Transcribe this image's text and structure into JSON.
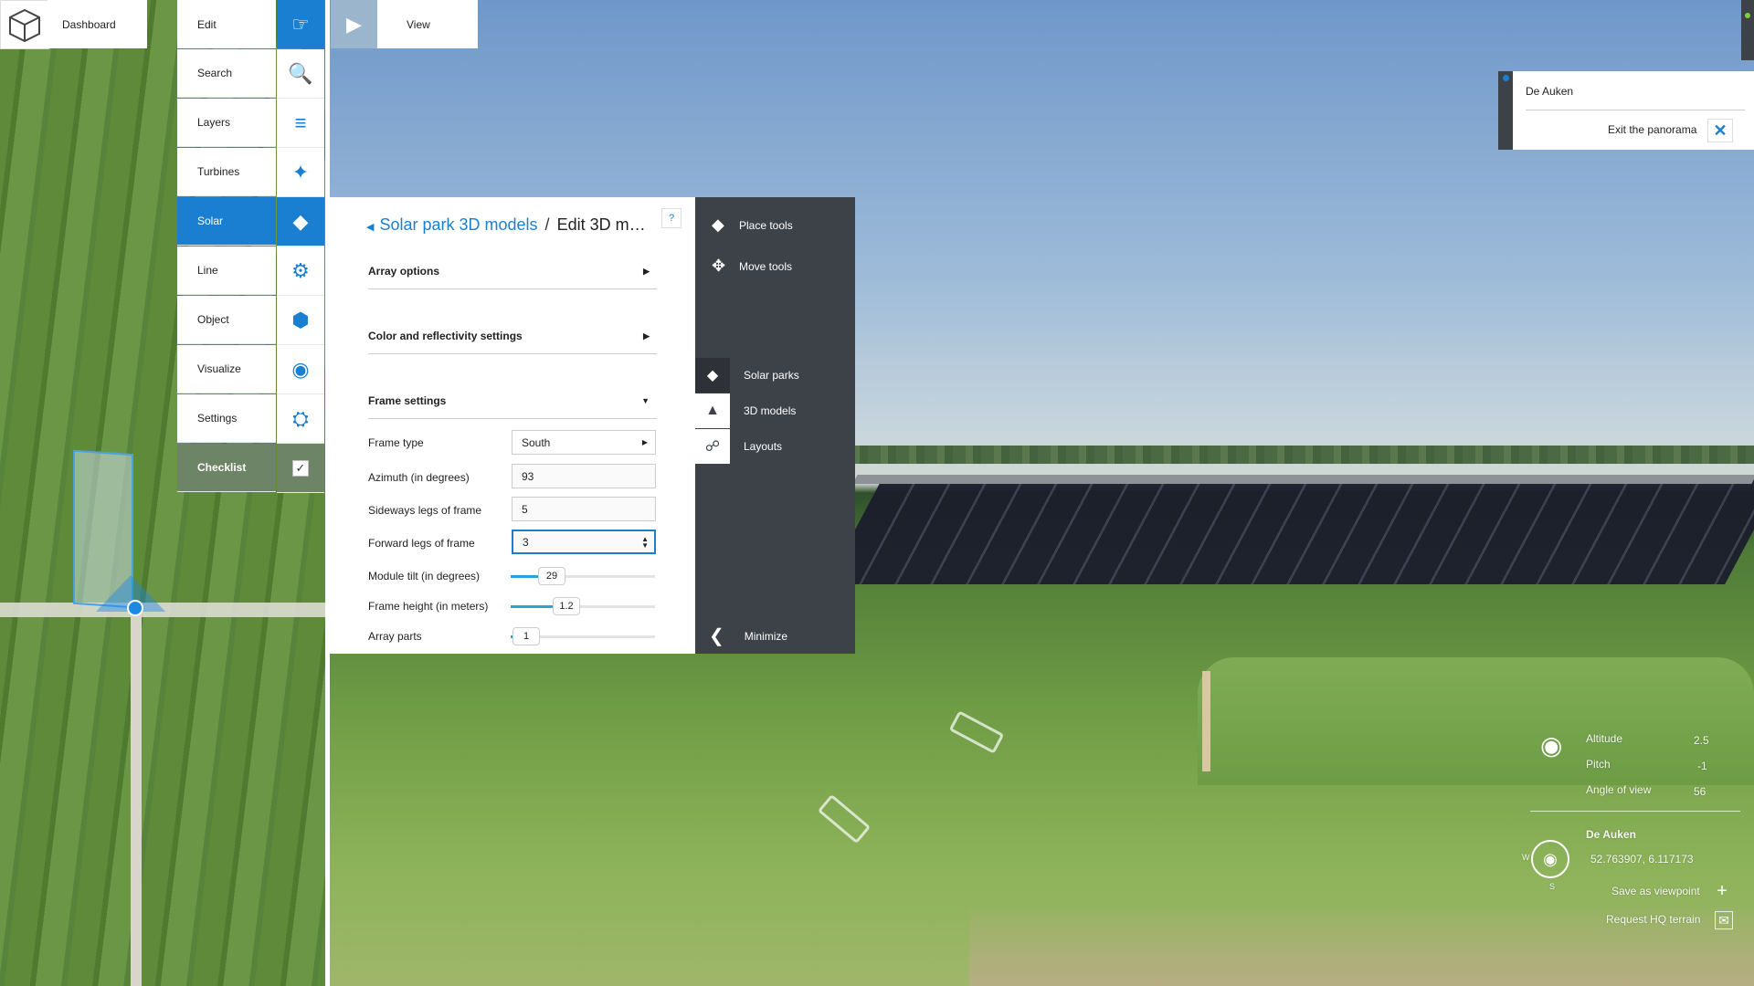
{
  "topbar": {
    "dashboard_label": "Dashboard",
    "edit_label": "Edit",
    "view_label": "View"
  },
  "menu": {
    "items": [
      {
        "label": "Search",
        "icon": "search-icon"
      },
      {
        "label": "Layers",
        "icon": "layers-icon"
      },
      {
        "label": "Turbines",
        "icon": "turbine-icon"
      },
      {
        "label": "Solar",
        "icon": "solar-panel-icon"
      },
      {
        "label": "Line",
        "icon": "line-icon"
      },
      {
        "label": "Object",
        "icon": "cube-icon"
      },
      {
        "label": "Visualize",
        "icon": "eye-icon"
      },
      {
        "label": "Settings",
        "icon": "gear-icon"
      },
      {
        "label": "Checklist",
        "icon": "checkbox-icon"
      }
    ],
    "active": "Solar"
  },
  "edit_panel": {
    "breadcrumb_parent": "Solar park 3D models",
    "breadcrumb_separator": "/",
    "breadcrumb_current": "Edit 3D m…",
    "help_label": "?",
    "sections": {
      "array_options": "Array options",
      "color_settings": "Color and reflectivity settings",
      "frame_settings": "Frame settings"
    },
    "fields": {
      "frame_type_label": "Frame type",
      "frame_type_value": "South",
      "azimuth_label": "Azimuth (in degrees)",
      "azimuth_value": "93",
      "sideways_legs_label": "Sideways legs of frame",
      "sideways_legs_value": "5",
      "forward_legs_label": "Forward legs of frame",
      "forward_legs_value": "3",
      "module_tilt_label": "Module tilt (in degrees)",
      "module_tilt_value": "29",
      "frame_height_label": "Frame height (in meters)",
      "frame_height_value": "1.2",
      "array_parts_label": "Array parts",
      "array_parts_value": "1"
    },
    "sliders": {
      "module_tilt_fraction": 0.18,
      "frame_height_fraction": 0.28,
      "array_parts_fraction": 0.0
    }
  },
  "tools_panel": {
    "place_tools": "Place tools",
    "move_tools": "Move tools",
    "solar_parks": "Solar parks",
    "models_3d": "3D models",
    "layouts": "Layouts",
    "minimize": "Minimize"
  },
  "info_panel": {
    "title": "De Auken",
    "exit_label": "Exit the panorama"
  },
  "hud": {
    "altitude_label": "Altitude",
    "altitude_value": "2.5",
    "pitch_label": "Pitch",
    "pitch_value": "-1",
    "fov_label": "Angle of view",
    "fov_value": "56",
    "location_name": "De Auken",
    "coordinates": "52.763907, 6.117173",
    "compass_w": "W",
    "compass_s": "S",
    "save_viewpoint": "Save as viewpoint",
    "request_terrain": "Request HQ terrain"
  },
  "colors": {
    "accent": "#1a7fd1",
    "dark_panel": "#3d4148",
    "checklist_bg": "#6e8466"
  }
}
